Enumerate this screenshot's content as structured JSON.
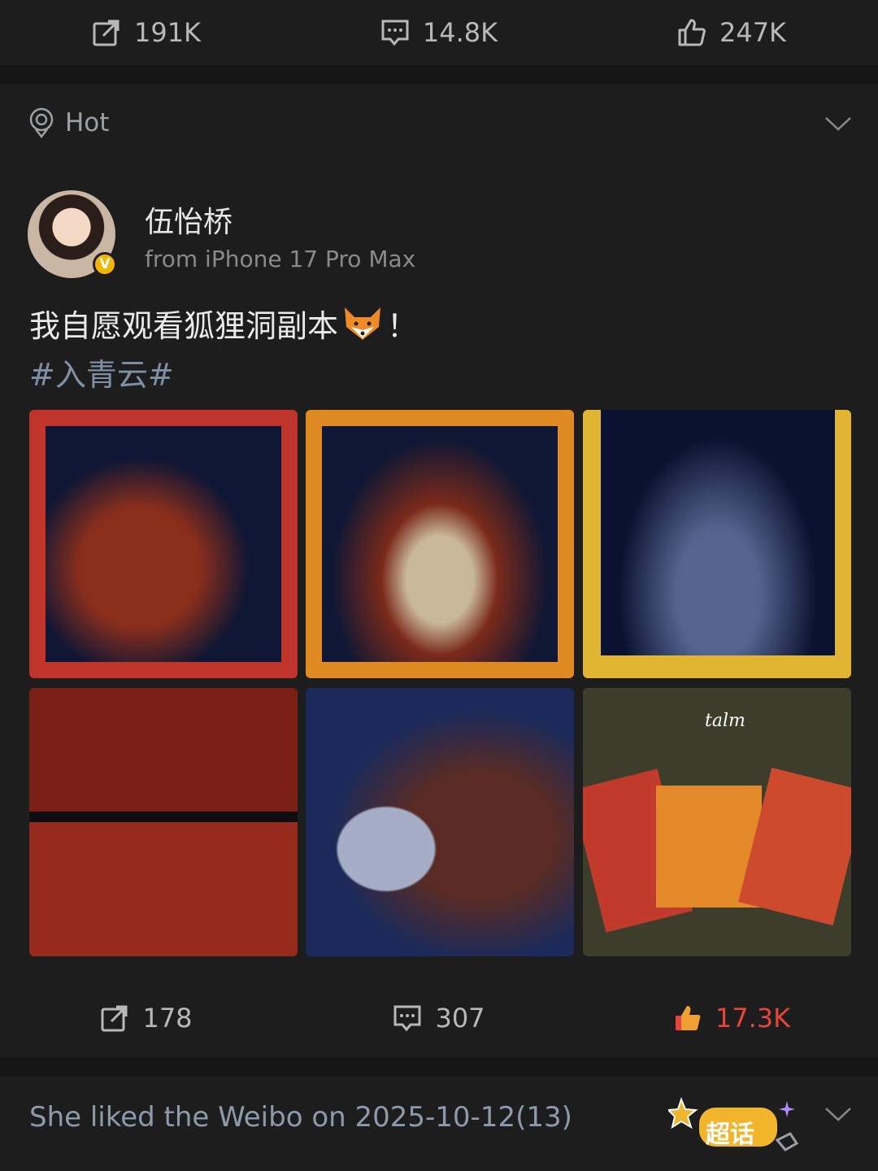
{
  "top_actions": {
    "repost_count": "191K",
    "comment_count": "14.8K",
    "like_count": "247K"
  },
  "section": {
    "label": "Hot"
  },
  "post": {
    "user_name": "伍怡桥",
    "verified_badge": "V",
    "source": "from iPhone 17 Pro Max",
    "text": "我自愿观看狐狸洞副本",
    "text_suffix": "！",
    "hashtag": "#入青云#",
    "photo_watermark": "talm",
    "repost_count": "178",
    "comment_count": "307",
    "like_count": "17.3K"
  },
  "liked_notice": {
    "text": "She liked the Weibo on 2025-10-12(13)",
    "super_topic_label": "超话"
  },
  "colors": {
    "background": "#161616",
    "card": "#1d1d1d",
    "like_active": "#e8443a",
    "hashtag": "#7f8fa6"
  },
  "icons": [
    "repost-icon",
    "comment-icon",
    "thumbs-up-icon",
    "hot-location-icon",
    "chevron-down-icon",
    "fox-emoji-icon",
    "super-topic-icon"
  ]
}
